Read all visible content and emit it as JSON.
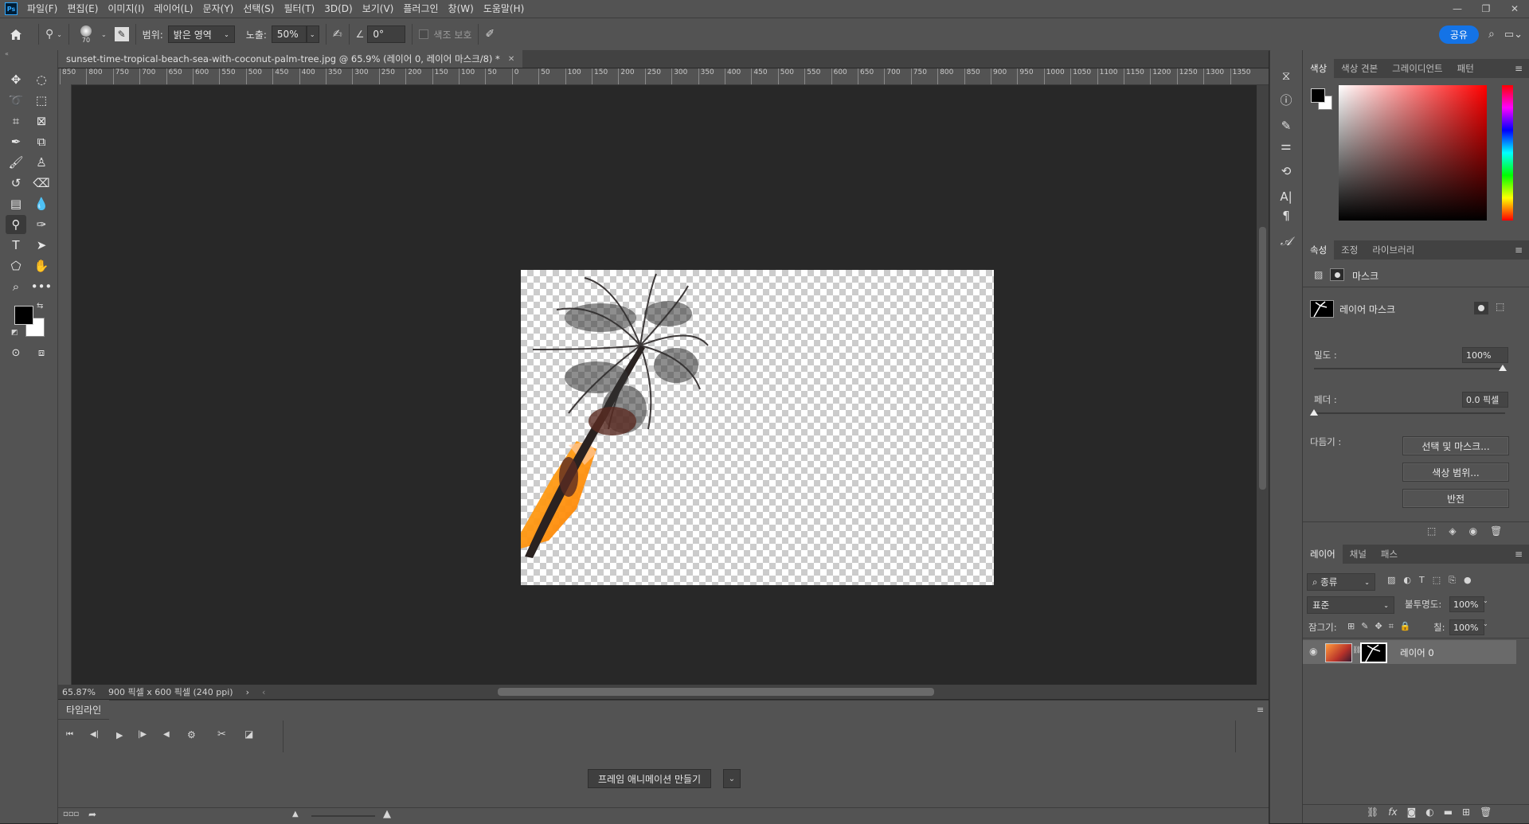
{
  "app": {
    "logo": "Ps"
  },
  "menu": [
    "파일(F)",
    "편집(E)",
    "이미지(I)",
    "레이어(L)",
    "문자(Y)",
    "선택(S)",
    "필터(T)",
    "3D(D)",
    "보기(V)",
    "플러그인",
    "창(W)",
    "도움말(H)"
  ],
  "options": {
    "brush_size": "70",
    "range_label": "범위:",
    "range_value": "밝은 영역",
    "exposure_label": "노출:",
    "exposure_value": "50%",
    "angle_value": "0°",
    "protect_tones_label": "색조 보호",
    "share_label": "공유"
  },
  "document": {
    "tab_title": "sunset-time-tropical-beach-sea-with-coconut-palm-tree.jpg @ 65.9% (레이어 0, 레이어 마스크/8) *",
    "zoom": "65.87%",
    "size_info": "900 픽셀 x 600 픽셀 (240 ppi)",
    "ruler_ticks": [
      "850",
      "800",
      "750",
      "700",
      "650",
      "600",
      "550",
      "500",
      "450",
      "400",
      "350",
      "300",
      "250",
      "200",
      "150",
      "100",
      "50",
      "0",
      "50",
      "100",
      "150",
      "200",
      "250",
      "300",
      "350",
      "400",
      "450",
      "500",
      "550",
      "600",
      "650",
      "700",
      "750",
      "800",
      "850",
      "900",
      "950",
      "1000",
      "1050",
      "1100",
      "1150",
      "1200",
      "1250",
      "1300",
      "1350"
    ]
  },
  "timeline": {
    "tab": "타임라인",
    "create_button": "프레임 애니메이션 만들기"
  },
  "color_panel": {
    "tabs": [
      "색상",
      "색상 견본",
      "그레이디언트",
      "패턴"
    ],
    "hue_color": "#ff0000"
  },
  "properties_panel": {
    "tabs": [
      "속성",
      "조정",
      "라이브러리"
    ],
    "mask_section_label": "마스크",
    "layer_mask_label": "레이어 마스크",
    "density_label": "밀도 :",
    "density_value": "100%",
    "feather_label": "페더 :",
    "feather_value": "0.0 픽셀",
    "refine_label": "다듬기 :",
    "select_mask_button": "선택 및 마스크...",
    "color_range_button": "색상 범위...",
    "invert_button": "반전"
  },
  "layers_panel": {
    "tabs": [
      "레이어",
      "채널",
      "패스"
    ],
    "filter_kind": "종류",
    "blend_mode": "표준",
    "opacity_label": "불투명도:",
    "opacity_value": "100%",
    "lock_label": "잠그기:",
    "fill_label": "칠:",
    "fill_value": "100%",
    "layers": [
      {
        "name": "레이어 0"
      }
    ]
  }
}
